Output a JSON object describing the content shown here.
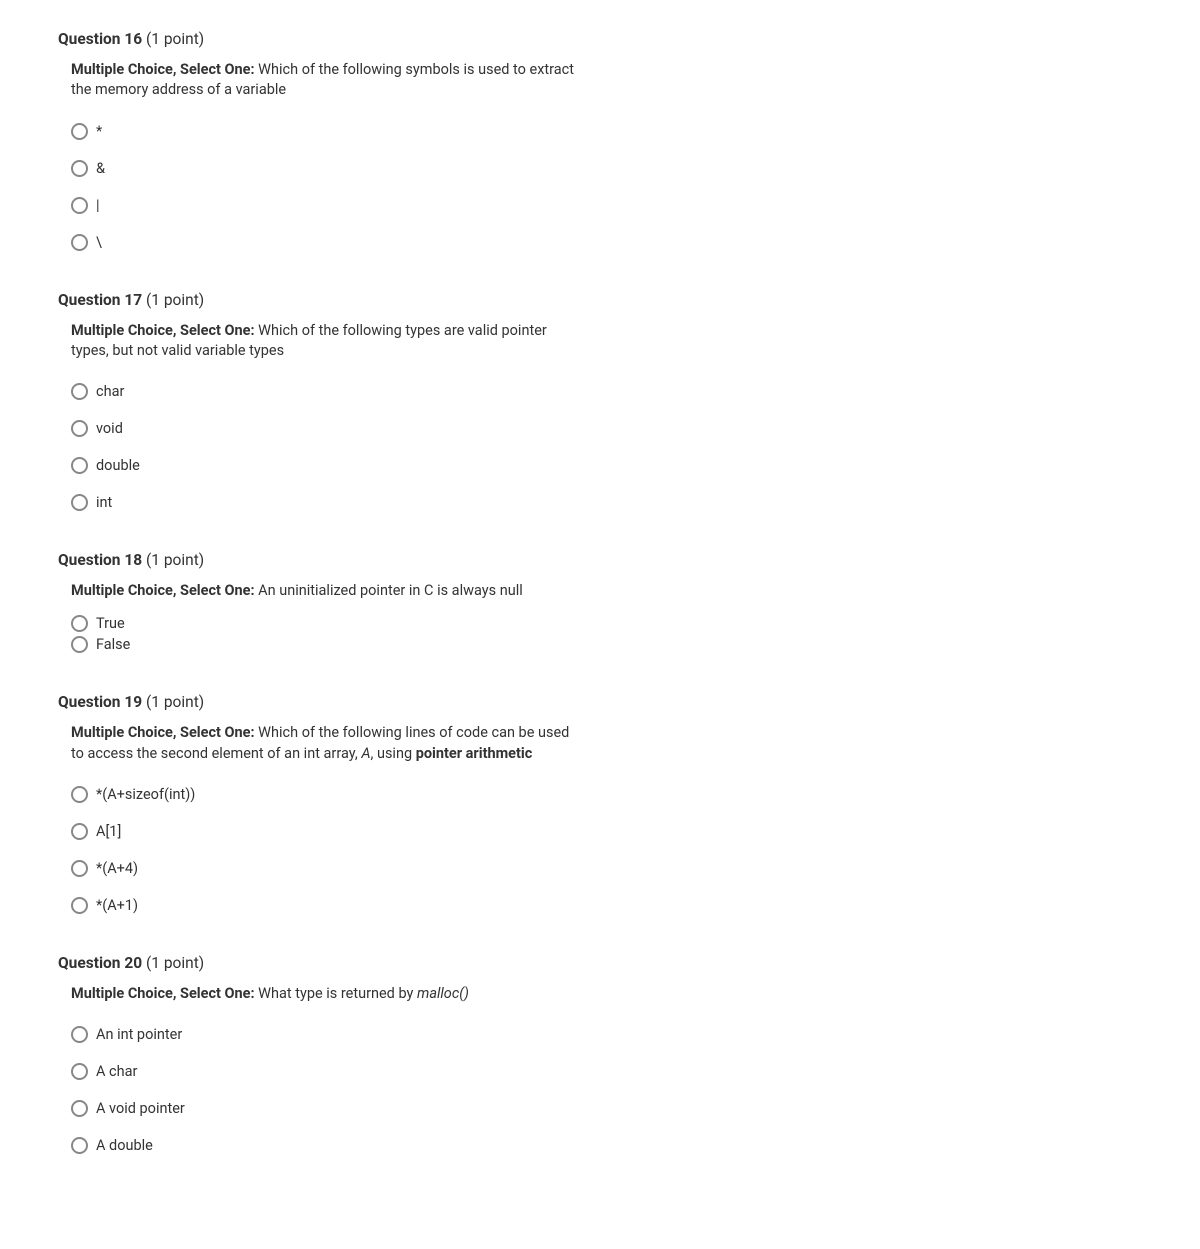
{
  "questions": [
    {
      "number": "Question 16",
      "points": "(1 point)",
      "prompt_prefix": "Multiple Choice, Select One:",
      "prompt_text": " Which of the following symbols is used to extract the memory address of a variable",
      "tight": false,
      "options": [
        {
          "label": "*"
        },
        {
          "label": "&"
        },
        {
          "label": "|"
        },
        {
          "label": "\\"
        }
      ]
    },
    {
      "number": "Question 17",
      "points": "(1 point)",
      "prompt_prefix": "Multiple Choice, Select One:",
      "prompt_text": " Which of the following types are valid pointer types, but not valid variable types",
      "tight": false,
      "options": [
        {
          "label": "char"
        },
        {
          "label": "void"
        },
        {
          "label": "double"
        },
        {
          "label": "int"
        }
      ]
    },
    {
      "number": "Question 18",
      "points": "(1 point)",
      "prompt_prefix": "Multiple Choice, Select One:",
      "prompt_text": " An uninitialized pointer in C is always null",
      "tight": true,
      "options": [
        {
          "label": "True"
        },
        {
          "label": "False"
        }
      ]
    },
    {
      "number": "Question 19",
      "points": "(1 point)",
      "prompt_prefix": "Multiple Choice, Select One:",
      "prompt_text_pre": " Which of the following lines of code can be used to access the second element of an int array, ",
      "prompt_italic": "A",
      "prompt_text_mid": ", using ",
      "prompt_bold": "pointer arithmetic",
      "prompt_text_post": "",
      "tight": false,
      "options": [
        {
          "label": "*(A+sizeof(int))"
        },
        {
          "label": "A[1]"
        },
        {
          "label": "*(A+4)"
        },
        {
          "label": "*(A+1)"
        }
      ]
    },
    {
      "number": "Question 20",
      "points": "(1 point)",
      "prompt_prefix": "Multiple Choice, Select One:",
      "prompt_text_pre": " What type is returned by ",
      "prompt_italic": "malloc()",
      "prompt_text_post": "",
      "tight": false,
      "options": [
        {
          "label": "An int pointer"
        },
        {
          "label": "A char"
        },
        {
          "label": "A void pointer"
        },
        {
          "label": "A double"
        }
      ]
    }
  ]
}
